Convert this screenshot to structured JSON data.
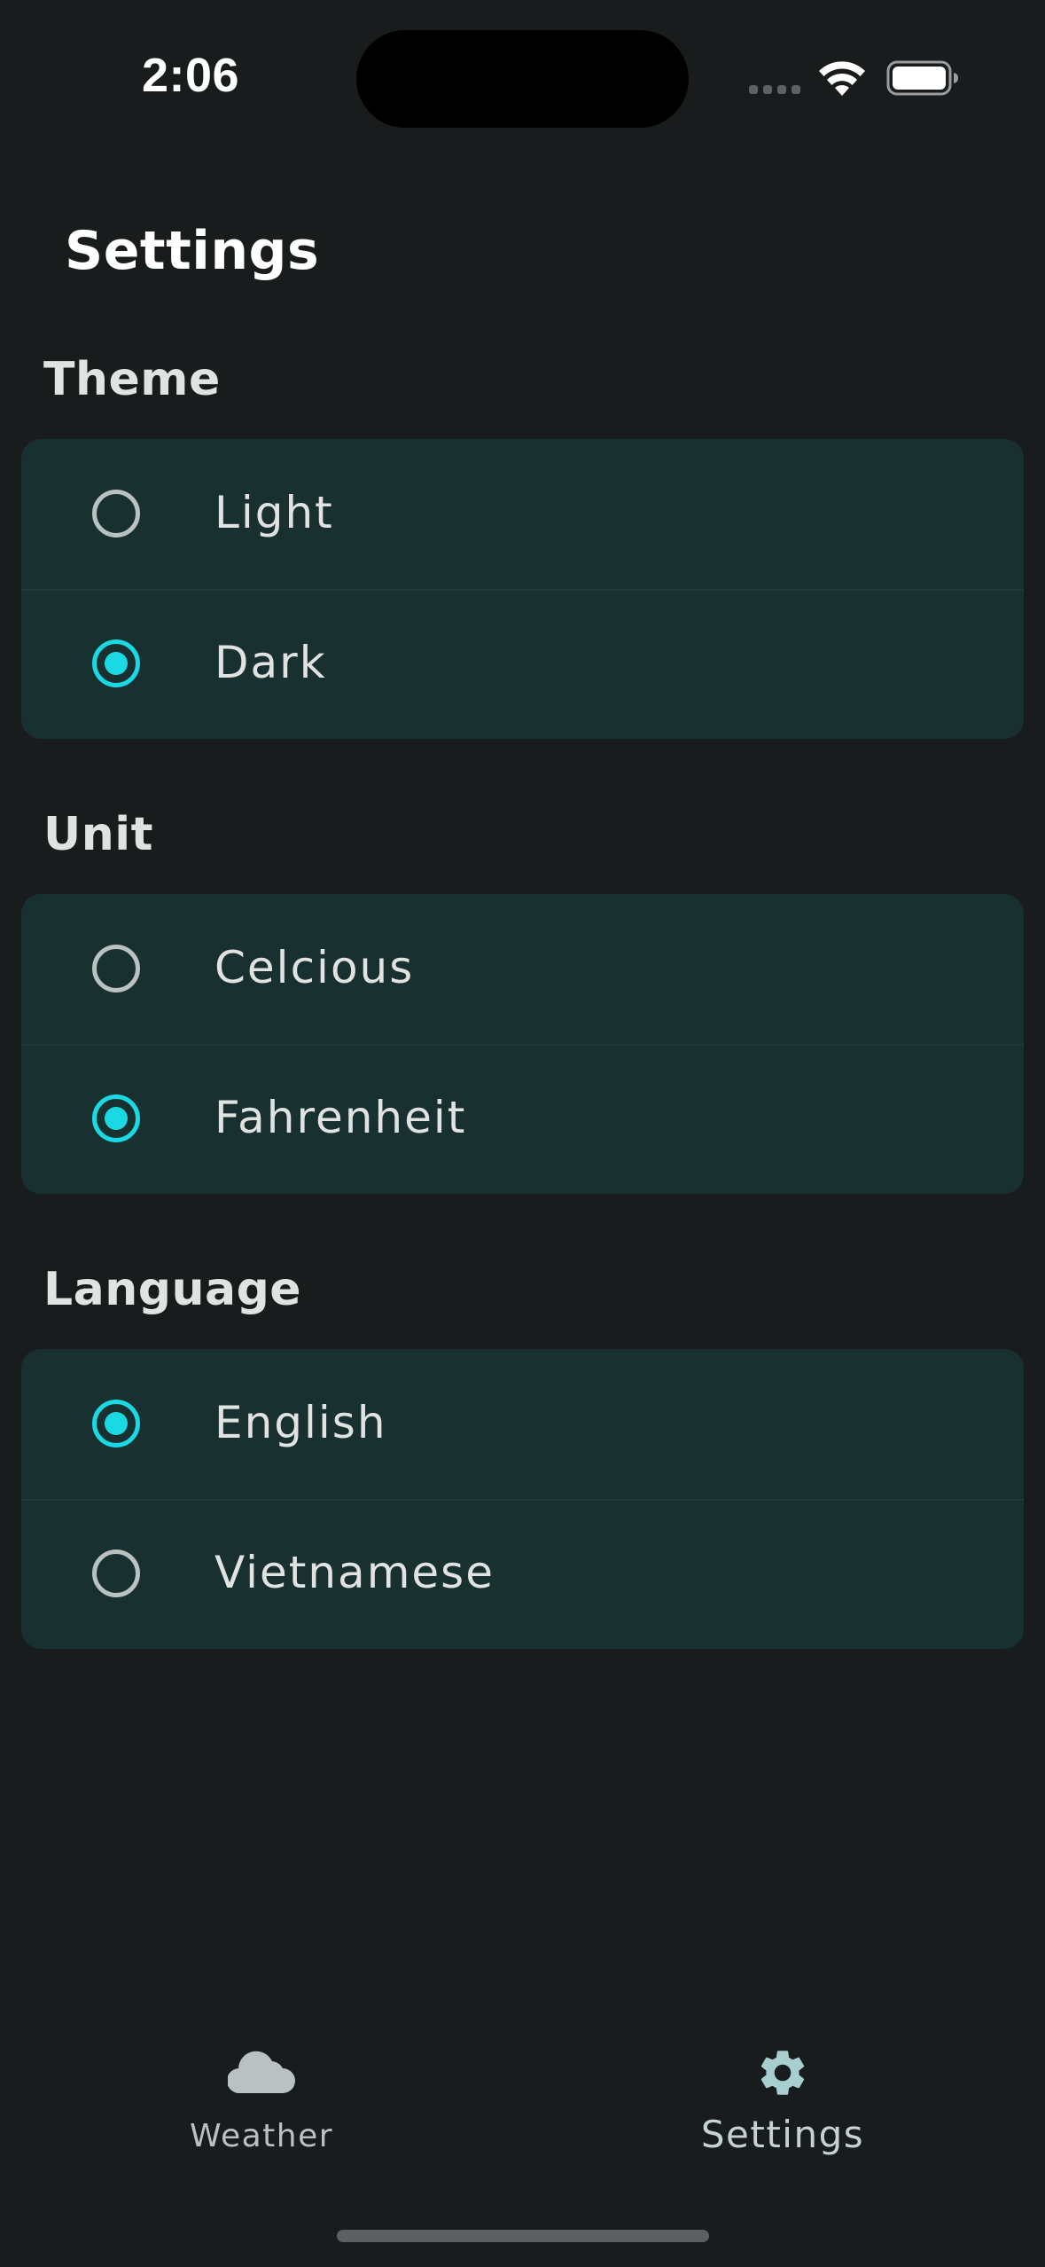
{
  "status_bar": {
    "time": "2:06"
  },
  "page": {
    "title": "Settings"
  },
  "sections": [
    {
      "heading": "Theme",
      "options": [
        {
          "label": "Light",
          "selected": false
        },
        {
          "label": "Dark",
          "selected": true
        }
      ]
    },
    {
      "heading": "Unit",
      "options": [
        {
          "label": "Celcious",
          "selected": false
        },
        {
          "label": "Fahrenheit",
          "selected": true
        }
      ]
    },
    {
      "heading": "Language",
      "options": [
        {
          "label": "English",
          "selected": true
        },
        {
          "label": "Vietnamese",
          "selected": false
        }
      ]
    }
  ],
  "bottom_nav": {
    "items": [
      {
        "label": "Weather",
        "icon": "cloud-icon",
        "active": false
      },
      {
        "label": "Settings",
        "icon": "gear-icon",
        "active": true
      }
    ]
  },
  "colors": {
    "background": "#191c1d",
    "card": "#193031",
    "accent": "#1ad9e2",
    "radio_unselected": "#b9c1c1"
  }
}
